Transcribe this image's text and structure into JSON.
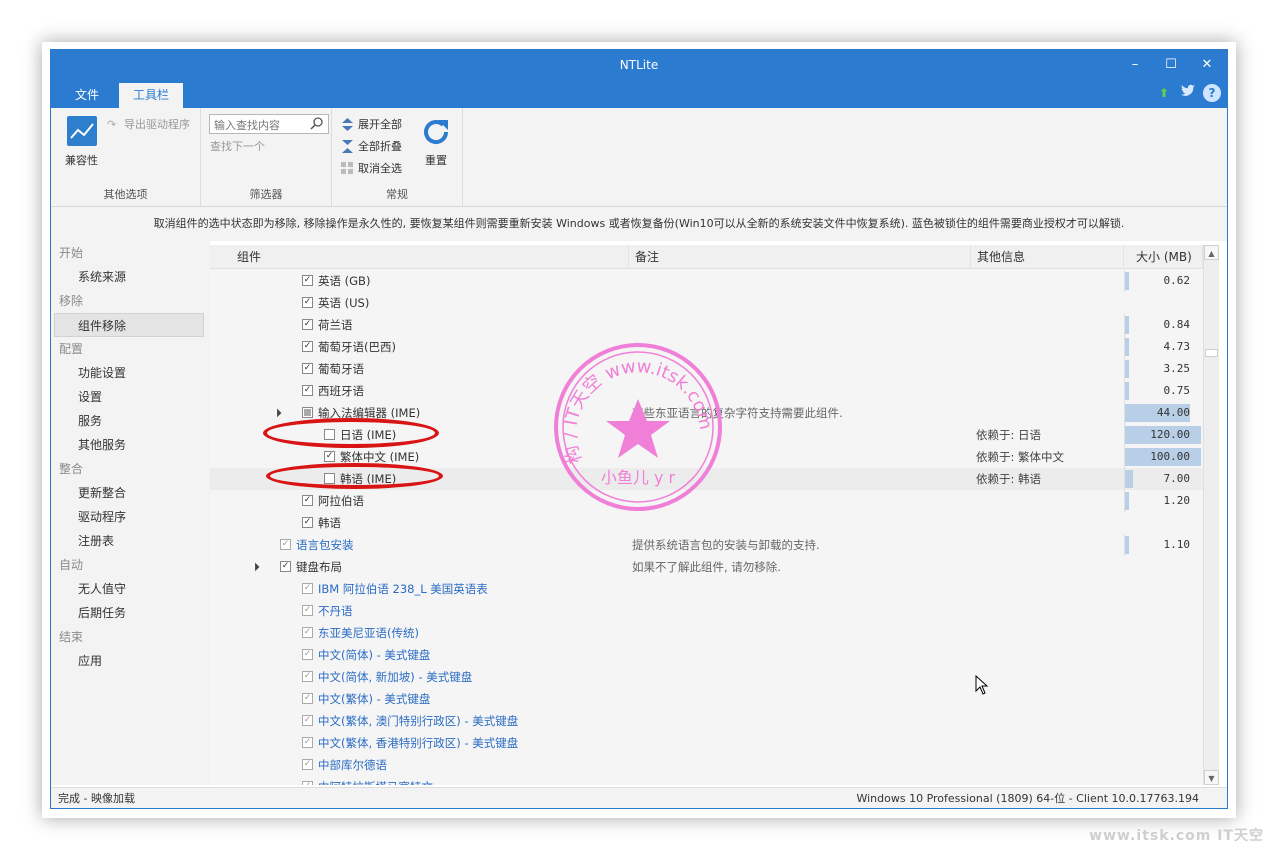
{
  "window": {
    "title": "NTLite"
  },
  "tabs": [
    {
      "label": "文件",
      "active": false
    },
    {
      "label": "工具栏",
      "active": true
    }
  ],
  "ribbon": {
    "groups": [
      {
        "label": "其他选项",
        "compat": "兼容性",
        "export": "导出驱动程序"
      },
      {
        "label": "筛选器",
        "search_placeholder": "输入查找内容",
        "find_next": "查找下一个"
      },
      {
        "label": "常规",
        "expand_all": "展开全部",
        "collapse_all": "全部折叠",
        "deselect_all": "取消全选",
        "reset": "重置"
      }
    ]
  },
  "notice": "取消组件的选中状态即为移除, 移除操作是永久性的, 要恢复某组件则需要重新安装 Windows 或者恢复备份(Win10可以从全新的系统安装文件中恢复系统). 蓝色被锁住的组件需要商业授权才可以解锁.",
  "nav": [
    {
      "type": "section",
      "label": "开始"
    },
    {
      "type": "item",
      "label": "系统来源"
    },
    {
      "type": "section",
      "label": "移除"
    },
    {
      "type": "item",
      "label": "组件移除",
      "active": true
    },
    {
      "type": "section",
      "label": "配置"
    },
    {
      "type": "item",
      "label": "功能设置"
    },
    {
      "type": "item",
      "label": "设置"
    },
    {
      "type": "item",
      "label": "服务"
    },
    {
      "type": "item",
      "label": "其他服务"
    },
    {
      "type": "section",
      "label": "整合"
    },
    {
      "type": "item",
      "label": "更新整合"
    },
    {
      "type": "item",
      "label": "驱动程序"
    },
    {
      "type": "item",
      "label": "注册表"
    },
    {
      "type": "section",
      "label": "自动"
    },
    {
      "type": "item",
      "label": "无人值守"
    },
    {
      "type": "item",
      "label": "后期任务"
    },
    {
      "type": "section",
      "label": "结束"
    },
    {
      "type": "item",
      "label": "应用"
    }
  ],
  "grid": {
    "columns": {
      "component": "组件",
      "note": "备注",
      "info": "其他信息",
      "size": "大小 (MB)"
    },
    "rows": [
      {
        "indent": 2,
        "check": "checked",
        "label": "英语 (GB)",
        "size": "0.62",
        "fill": 0.0
      },
      {
        "indent": 2,
        "check": "checked",
        "label": "英语 (US)"
      },
      {
        "indent": 2,
        "check": "checked",
        "label": "荷兰语",
        "size": "0.84",
        "fill": 0.0
      },
      {
        "indent": 2,
        "check": "checked",
        "label": "葡萄牙语(巴西)",
        "size": "4.73",
        "fill": 0.05
      },
      {
        "indent": 2,
        "check": "checked",
        "label": "葡萄牙语",
        "size": "3.25",
        "fill": 0.05
      },
      {
        "indent": 2,
        "check": "checked",
        "label": "西班牙语",
        "size": "0.75",
        "fill": 0.0
      },
      {
        "indent": 2,
        "check": "partial",
        "expander": "▲",
        "label": "输入法编辑器 (IME)",
        "note": "某些东亚语言的复杂字符支持需要此组件.",
        "size": "44.00",
        "fill": 0.85
      },
      {
        "indent": 3,
        "check": "unchecked",
        "label": "日语 (IME)",
        "info": "依赖于: 日语",
        "size": "120.00",
        "fill": 1.0
      },
      {
        "indent": 3,
        "check": "checked",
        "label": "繁体中文 (IME)",
        "info": "依赖于: 繁体中文",
        "size": "100.00",
        "fill": 1.0
      },
      {
        "indent": 3,
        "check": "unchecked",
        "label": "韩语 (IME)",
        "info": "依赖于: 韩语",
        "size": "7.00",
        "fill": 0.1,
        "selected": true
      },
      {
        "indent": 2,
        "check": "checked",
        "label": "阿拉伯语",
        "size": "1.20",
        "fill": 0.0
      },
      {
        "indent": 2,
        "check": "checked",
        "label": "韩语"
      },
      {
        "indent": 1,
        "check": "gray",
        "label": "语言包安装",
        "style": "blue",
        "note": "提供系统语言包的安装与卸载的支持.",
        "size": "1.10",
        "fill": 0.0
      },
      {
        "indent": 1,
        "check": "checked",
        "expander": "▲",
        "label": "键盘布局",
        "note": "如果不了解此组件, 请勿移除."
      },
      {
        "indent": 2,
        "check": "gray",
        "label": "IBM 阿拉伯语 238_L 美国英语表",
        "style": "blue"
      },
      {
        "indent": 2,
        "check": "gray",
        "label": "不丹语",
        "style": "blue"
      },
      {
        "indent": 2,
        "check": "gray",
        "label": "东亚美尼亚语(传统)",
        "style": "blue"
      },
      {
        "indent": 2,
        "check": "gray",
        "label": "中文(简体) - 美式键盘",
        "style": "blue"
      },
      {
        "indent": 2,
        "check": "gray",
        "label": "中文(简体, 新加坡) - 美式键盘",
        "style": "blue"
      },
      {
        "indent": 2,
        "check": "gray",
        "label": "中文(繁体) - 美式键盘",
        "style": "blue"
      },
      {
        "indent": 2,
        "check": "gray",
        "label": "中文(繁体, 澳门特别行政区) - 美式键盘",
        "style": "blue"
      },
      {
        "indent": 2,
        "check": "gray",
        "label": "中文(繁体, 香港特别行政区) - 美式键盘",
        "style": "blue"
      },
      {
        "indent": 2,
        "check": "gray",
        "label": "中部库尔德语",
        "style": "blue"
      },
      {
        "indent": 2,
        "check": "gray",
        "label": "中阿特拉斯塔马塞特文",
        "style": "blue"
      }
    ]
  },
  "status": {
    "left": "完成 - 映像加载",
    "right": "Windows 10 Professional (1809) 64-位 - Client 10.0.17763.194"
  },
  "stamp": {
    "arc_text": "构 / IT天空 www.itsk.com",
    "bottom_text": "小鱼儿 y r"
  },
  "watermark": "www.itsk.com IT天空",
  "colors": {
    "title_bar": "#2b7bd0",
    "annotation_red": "#d81414",
    "stamp_pink": "#f07fd8",
    "size_bar": "#b9cfe8"
  }
}
